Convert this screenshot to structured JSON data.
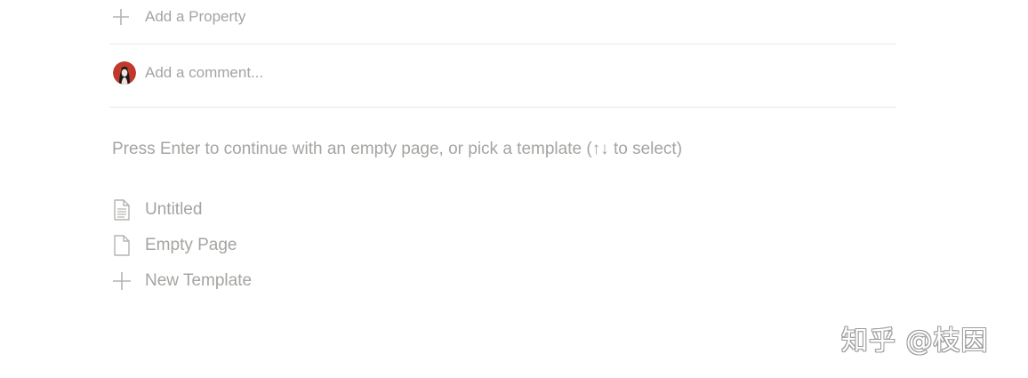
{
  "properties": {
    "add_label": "Add a Property",
    "icon": "plus-icon"
  },
  "comment": {
    "placeholder": "Add a comment...",
    "avatar": "user-avatar"
  },
  "hint": "Press Enter to continue with an empty page, or pick a template (↑↓ to select)",
  "templates": [
    {
      "label": "Untitled",
      "icon": "document-lines-icon"
    },
    {
      "label": "Empty Page",
      "icon": "document-blank-icon"
    },
    {
      "label": "New Template",
      "icon": "plus-icon"
    }
  ],
  "watermark": "知乎 @枝因",
  "colors": {
    "muted_text": "#a5a4a1",
    "divider": "#e9e9e7",
    "avatar_red": "#c0392b"
  }
}
